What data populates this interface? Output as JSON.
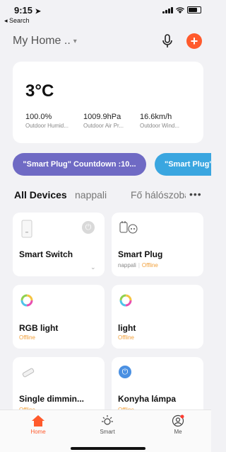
{
  "status_bar": {
    "time": "9:15",
    "back_label": "◂ Search"
  },
  "header": {
    "home_name": "My Home ..",
    "caret": "▾",
    "add_label": "+"
  },
  "weather": {
    "temperature": "3°C",
    "items": [
      {
        "value": "100.0%",
        "label": "Outdoor Humid..."
      },
      {
        "value": "1009.9hPa",
        "label": "Outdoor Air Pr..."
      },
      {
        "value": "16.6km/h",
        "label": "Outdoor Wind..."
      }
    ]
  },
  "scenes": [
    {
      "label": "\"Smart Plug\" Countdown :10...",
      "color": "#6f6ac4"
    },
    {
      "label": "\"Smart Plug\"",
      "color": "#3aa6e0"
    }
  ],
  "tabs": [
    {
      "label": "All Devices"
    },
    {
      "label": "nappali"
    },
    {
      "label": "Fő hálószoba"
    }
  ],
  "more_label": "•••",
  "devices": [
    {
      "name": "Smart Switch",
      "room": "",
      "status": ""
    },
    {
      "name": "Smart Plug",
      "room": "nappali",
      "status": "Offline"
    },
    {
      "name": "RGB light",
      "room": "",
      "status": "Offline"
    },
    {
      "name": "light",
      "room": "",
      "status": "Offline"
    },
    {
      "name": "Single dimmin...",
      "room": "",
      "status": "Offline"
    },
    {
      "name": "Konyha lámpa",
      "room": "",
      "status": "Offline"
    }
  ],
  "bottom_nav": [
    {
      "label": "Home",
      "icon": "home-icon"
    },
    {
      "label": "Smart",
      "icon": "sun-icon"
    },
    {
      "label": "Me",
      "icon": "profile-icon"
    }
  ],
  "colors": {
    "accent": "#ff5a2c",
    "offline": "#f2a13c"
  }
}
